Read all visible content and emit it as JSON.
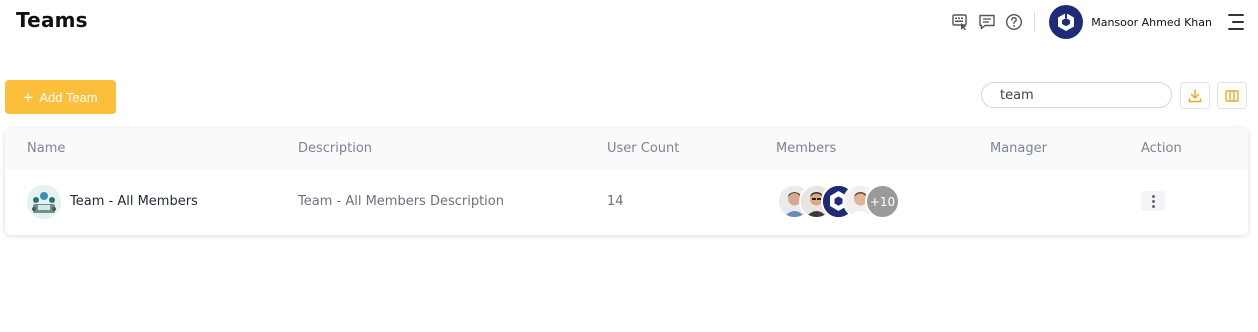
{
  "page": {
    "title": "Teams"
  },
  "header": {
    "user_name": "Mansoor Ahmed Khan",
    "icons": [
      "keyboard-pointer-icon",
      "chat-icon",
      "help-icon",
      "menu-icon"
    ]
  },
  "toolbar": {
    "add_label": "Add Team",
    "search_value": "team",
    "accent": "#fbbf3c"
  },
  "table": {
    "headers": [
      "Name",
      "Description",
      "User Count",
      "Members",
      "Manager",
      "Action"
    ],
    "rows": [
      {
        "name": "Team - All Members",
        "description": "Team - All Members Description",
        "user_count": "14",
        "members_more": "+10",
        "manager": ""
      }
    ]
  }
}
